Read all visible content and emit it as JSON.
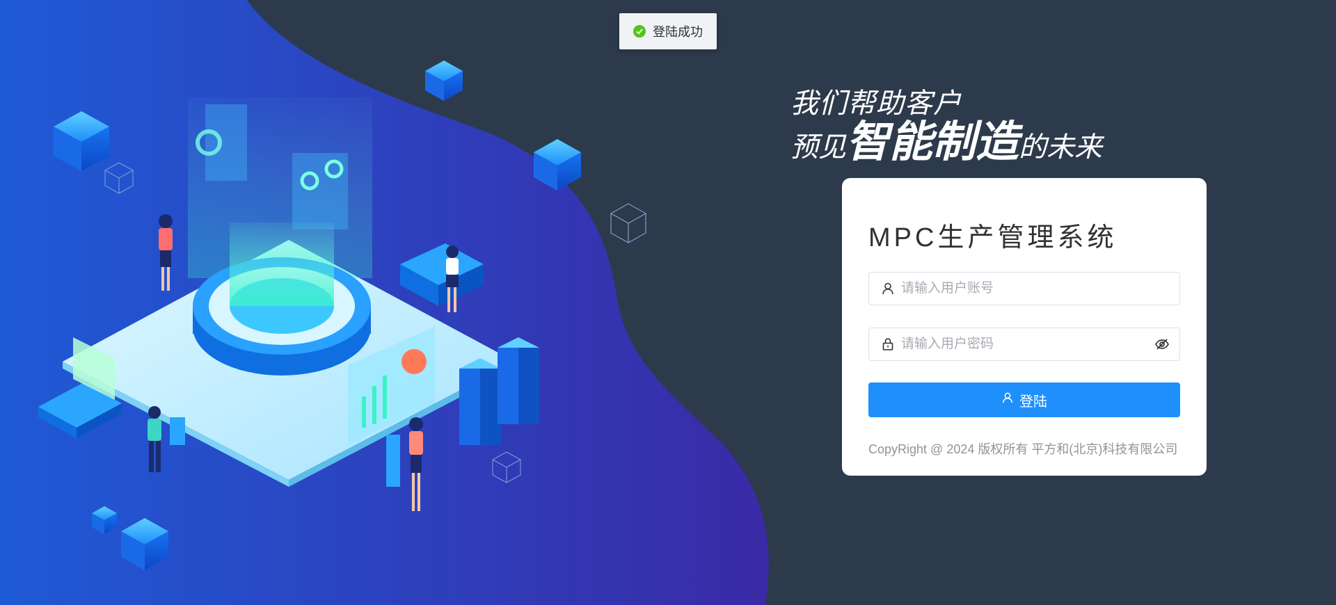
{
  "toast": {
    "message": "登陆成功",
    "icon": "check-circle-icon",
    "color": "#52c41a"
  },
  "slogan": {
    "line1": "我们帮助客户",
    "line2_prefix": "预见",
    "line2_emphasis": "智能制造",
    "line2_suffix": "的未来"
  },
  "login": {
    "title": "MPC生产管理系统",
    "username": {
      "placeholder": "请输入用户账号",
      "value": "",
      "icon": "user-icon"
    },
    "password": {
      "placeholder": "请输入用户密码",
      "value": "",
      "icon": "lock-icon",
      "toggle_icon": "eye-off-icon"
    },
    "submit_label": "登陆",
    "submit_icon": "user-icon",
    "copyright": "CopyRight @ 2024 版权所有 平方和(北京)科技有限公司"
  },
  "colors": {
    "page_background": "#2d3a4b",
    "blob_left": "#1f5ad6",
    "blob_right": "#3a2aa6",
    "primary": "#1e8ffb",
    "card": "#ffffff"
  }
}
